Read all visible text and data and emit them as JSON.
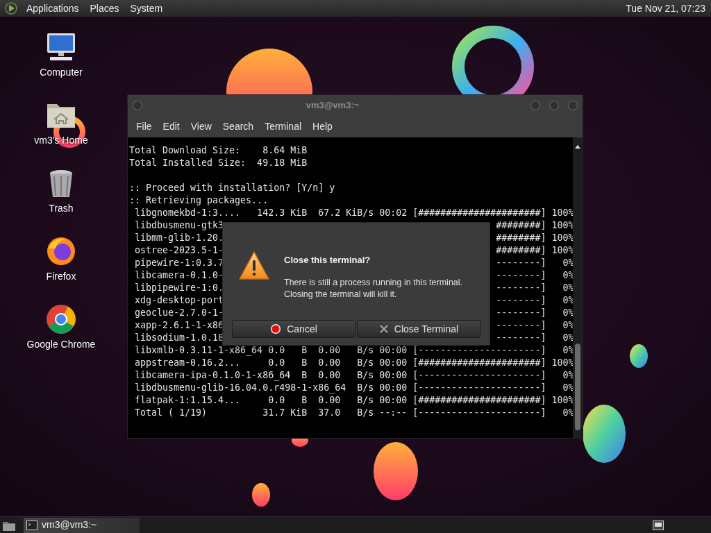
{
  "top_panel": {
    "menus": [
      "Applications",
      "Places",
      "System"
    ],
    "clock": "Tue Nov 21, 07:23"
  },
  "desktop_icons": [
    {
      "label": "Computer",
      "kind": "computer"
    },
    {
      "label": "vm3's Home",
      "kind": "home"
    },
    {
      "label": "Trash",
      "kind": "trash"
    },
    {
      "label": "Firefox",
      "kind": "firefox"
    },
    {
      "label": "Google Chrome",
      "kind": "chrome"
    }
  ],
  "terminal": {
    "title": "vm3@vm3:~",
    "menu": [
      "File",
      "Edit",
      "View",
      "Search",
      "Terminal",
      "Help"
    ],
    "lines": [
      {
        "kind": "full",
        "text": "Total Download Size:    8.64 MiB"
      },
      {
        "kind": "full",
        "text": "Total Installed Size:  49.18 MiB"
      },
      {
        "kind": "blank"
      },
      {
        "kind": "full",
        "text": ":: Proceed with installation? [Y/n] y"
      },
      {
        "kind": "full",
        "text": ":: Retrieving packages..."
      },
      {
        "kind": "full",
        "text": " libgnomekbd-1:3....   142.3 KiB  67.2 KiB/s 00:02 [######################] 100%"
      },
      {
        "kind": "split",
        "left": " libdbusmenu-gtk3",
        "right": "########] 100%"
      },
      {
        "kind": "split",
        "left": " libmm-glib-1.20.",
        "right": "########] 100%"
      },
      {
        "kind": "split",
        "left": " ostree-2023.5-1-",
        "right": "########] 100%"
      },
      {
        "kind": "split",
        "left": " pipewire-1:0.3.7",
        "right": "--------]   0%"
      },
      {
        "kind": "split",
        "left": " libcamera-0.1.0-",
        "right": "--------]   0%"
      },
      {
        "kind": "split",
        "left": " libpipewire-1:0.",
        "right": "--------]   0%"
      },
      {
        "kind": "split",
        "left": " xdg-desktop-port",
        "right": "--------]   0%"
      },
      {
        "kind": "split",
        "left": " geoclue-2.7.0-1-",
        "right": "--------]   0%"
      },
      {
        "kind": "split",
        "left": " xapp-2.6.1-1-x86",
        "right": "--------]   0%"
      },
      {
        "kind": "split",
        "left": " libsodium-1.0.18",
        "right": "--------]   0%"
      },
      {
        "kind": "full",
        "text": " libxmlb-0.3.11-1-x86_64 0.0   B  0.00   B/s 00:00 [----------------------]   0%"
      },
      {
        "kind": "full",
        "text": " appstream-0.16.2...     0.0   B  0.00   B/s 00:00 [######################] 100%"
      },
      {
        "kind": "full",
        "text": " libcamera-ipa-0.1.0-1-x86_64  B  0.00   B/s 00:00 [----------------------]   0%"
      },
      {
        "kind": "full",
        "text": " libdbusmenu-glib-16.04.0.r498-1-x86_64  B/s 00:00 [----------------------]   0%"
      },
      {
        "kind": "full",
        "text": " flatpak-1:1.15.4...     0.0   B  0.00   B/s 00:00 [######################] 100%"
      },
      {
        "kind": "full",
        "text": " Total ( 1/19)          31.7 KiB  37.0   B/s --:-- [----------------------]   0%"
      }
    ]
  },
  "dialog": {
    "title": "Close this terminal?",
    "message_lines": [
      "There is still a process running in this terminal.",
      "Closing the terminal will kill it."
    ],
    "buttons": [
      {
        "label": "Cancel",
        "kind": "cancel"
      },
      {
        "label": "Close Terminal",
        "kind": "close"
      }
    ]
  },
  "taskbar": {
    "tasks": [
      "vm3@vm3:~"
    ]
  }
}
